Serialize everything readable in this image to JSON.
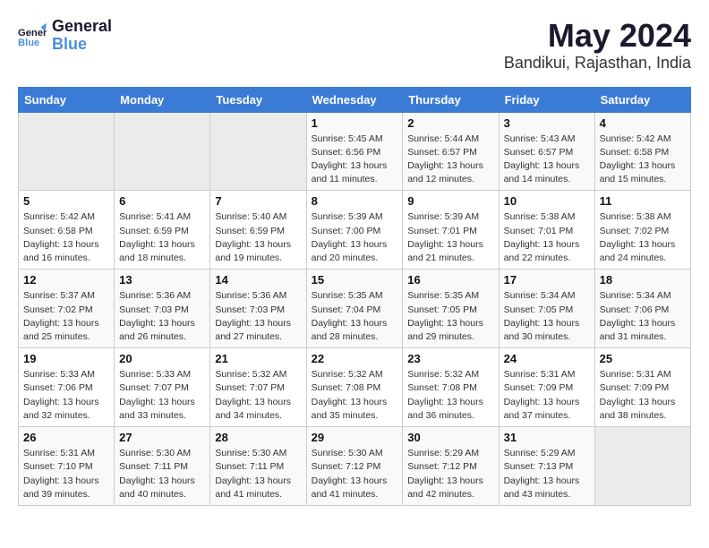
{
  "logo": {
    "line1": "General",
    "line2": "Blue"
  },
  "title": {
    "month": "May 2024",
    "location": "Bandikui, Rajasthan, India"
  },
  "header": {
    "days": [
      "Sunday",
      "Monday",
      "Tuesday",
      "Wednesday",
      "Thursday",
      "Friday",
      "Saturday"
    ]
  },
  "weeks": [
    {
      "cells": [
        {
          "empty": true
        },
        {
          "empty": true
        },
        {
          "empty": true
        },
        {
          "day": "1",
          "info": "Sunrise: 5:45 AM\nSunset: 6:56 PM\nDaylight: 13 hours\nand 11 minutes."
        },
        {
          "day": "2",
          "info": "Sunrise: 5:44 AM\nSunset: 6:57 PM\nDaylight: 13 hours\nand 12 minutes."
        },
        {
          "day": "3",
          "info": "Sunrise: 5:43 AM\nSunset: 6:57 PM\nDaylight: 13 hours\nand 14 minutes."
        },
        {
          "day": "4",
          "info": "Sunrise: 5:42 AM\nSunset: 6:58 PM\nDaylight: 13 hours\nand 15 minutes."
        }
      ]
    },
    {
      "cells": [
        {
          "day": "5",
          "info": "Sunrise: 5:42 AM\nSunset: 6:58 PM\nDaylight: 13 hours\nand 16 minutes."
        },
        {
          "day": "6",
          "info": "Sunrise: 5:41 AM\nSunset: 6:59 PM\nDaylight: 13 hours\nand 18 minutes."
        },
        {
          "day": "7",
          "info": "Sunrise: 5:40 AM\nSunset: 6:59 PM\nDaylight: 13 hours\nand 19 minutes."
        },
        {
          "day": "8",
          "info": "Sunrise: 5:39 AM\nSunset: 7:00 PM\nDaylight: 13 hours\nand 20 minutes."
        },
        {
          "day": "9",
          "info": "Sunrise: 5:39 AM\nSunset: 7:01 PM\nDaylight: 13 hours\nand 21 minutes."
        },
        {
          "day": "10",
          "info": "Sunrise: 5:38 AM\nSunset: 7:01 PM\nDaylight: 13 hours\nand 22 minutes."
        },
        {
          "day": "11",
          "info": "Sunrise: 5:38 AM\nSunset: 7:02 PM\nDaylight: 13 hours\nand 24 minutes."
        }
      ]
    },
    {
      "cells": [
        {
          "day": "12",
          "info": "Sunrise: 5:37 AM\nSunset: 7:02 PM\nDaylight: 13 hours\nand 25 minutes."
        },
        {
          "day": "13",
          "info": "Sunrise: 5:36 AM\nSunset: 7:03 PM\nDaylight: 13 hours\nand 26 minutes."
        },
        {
          "day": "14",
          "info": "Sunrise: 5:36 AM\nSunset: 7:03 PM\nDaylight: 13 hours\nand 27 minutes."
        },
        {
          "day": "15",
          "info": "Sunrise: 5:35 AM\nSunset: 7:04 PM\nDaylight: 13 hours\nand 28 minutes."
        },
        {
          "day": "16",
          "info": "Sunrise: 5:35 AM\nSunset: 7:05 PM\nDaylight: 13 hours\nand 29 minutes."
        },
        {
          "day": "17",
          "info": "Sunrise: 5:34 AM\nSunset: 7:05 PM\nDaylight: 13 hours\nand 30 minutes."
        },
        {
          "day": "18",
          "info": "Sunrise: 5:34 AM\nSunset: 7:06 PM\nDaylight: 13 hours\nand 31 minutes."
        }
      ]
    },
    {
      "cells": [
        {
          "day": "19",
          "info": "Sunrise: 5:33 AM\nSunset: 7:06 PM\nDaylight: 13 hours\nand 32 minutes."
        },
        {
          "day": "20",
          "info": "Sunrise: 5:33 AM\nSunset: 7:07 PM\nDaylight: 13 hours\nand 33 minutes."
        },
        {
          "day": "21",
          "info": "Sunrise: 5:32 AM\nSunset: 7:07 PM\nDaylight: 13 hours\nand 34 minutes."
        },
        {
          "day": "22",
          "info": "Sunrise: 5:32 AM\nSunset: 7:08 PM\nDaylight: 13 hours\nand 35 minutes."
        },
        {
          "day": "23",
          "info": "Sunrise: 5:32 AM\nSunset: 7:08 PM\nDaylight: 13 hours\nand 36 minutes."
        },
        {
          "day": "24",
          "info": "Sunrise: 5:31 AM\nSunset: 7:09 PM\nDaylight: 13 hours\nand 37 minutes."
        },
        {
          "day": "25",
          "info": "Sunrise: 5:31 AM\nSunset: 7:09 PM\nDaylight: 13 hours\nand 38 minutes."
        }
      ]
    },
    {
      "cells": [
        {
          "day": "26",
          "info": "Sunrise: 5:31 AM\nSunset: 7:10 PM\nDaylight: 13 hours\nand 39 minutes."
        },
        {
          "day": "27",
          "info": "Sunrise: 5:30 AM\nSunset: 7:11 PM\nDaylight: 13 hours\nand 40 minutes."
        },
        {
          "day": "28",
          "info": "Sunrise: 5:30 AM\nSunset: 7:11 PM\nDaylight: 13 hours\nand 41 minutes."
        },
        {
          "day": "29",
          "info": "Sunrise: 5:30 AM\nSunset: 7:12 PM\nDaylight: 13 hours\nand 41 minutes."
        },
        {
          "day": "30",
          "info": "Sunrise: 5:29 AM\nSunset: 7:12 PM\nDaylight: 13 hours\nand 42 minutes."
        },
        {
          "day": "31",
          "info": "Sunrise: 5:29 AM\nSunset: 7:13 PM\nDaylight: 13 hours\nand 43 minutes."
        },
        {
          "empty": true
        }
      ]
    }
  ]
}
